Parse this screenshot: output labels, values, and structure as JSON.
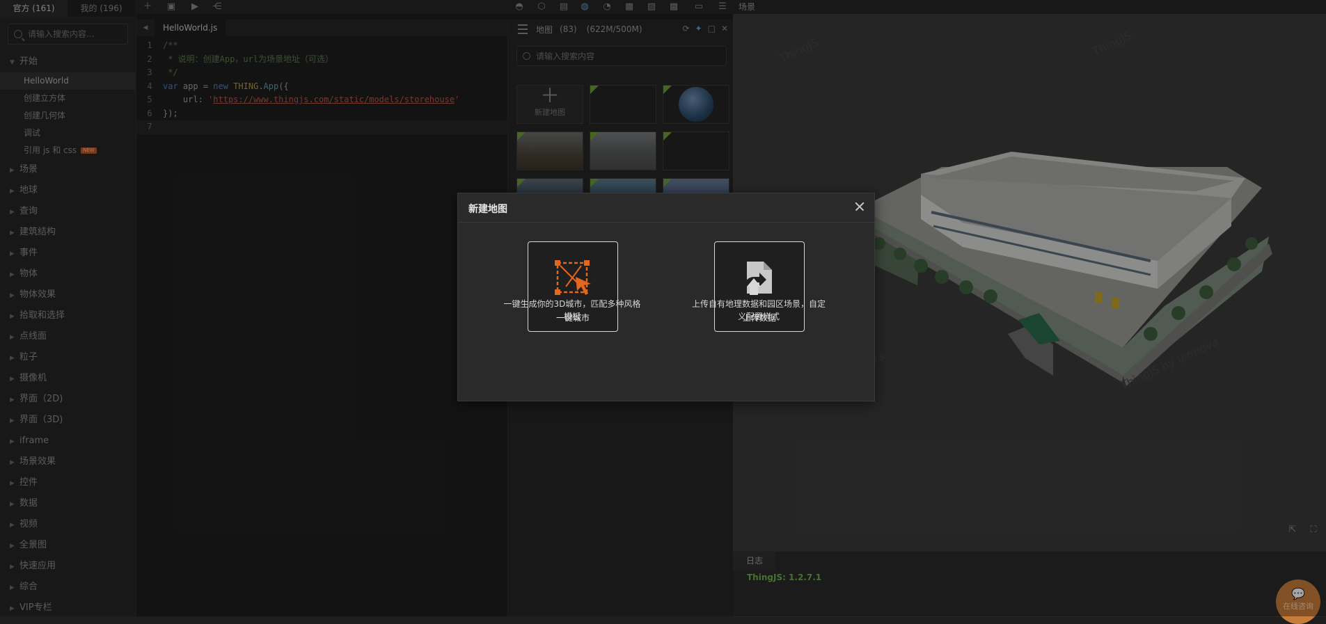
{
  "sidebar": {
    "tabs": [
      {
        "label": "官方 (161)"
      },
      {
        "label": "我的 (196)"
      }
    ],
    "search_placeholder": "请输入搜索内容...",
    "start_section": "开始",
    "start_items": [
      {
        "label": "HelloWorld",
        "active": true
      },
      {
        "label": "创建立方体"
      },
      {
        "label": "创建几何体"
      },
      {
        "label": "调试"
      },
      {
        "label": "引用 js 和 css",
        "badge": "NEW"
      }
    ],
    "sections": [
      "场景",
      "地球",
      "查询",
      "建筑结构",
      "事件",
      "物体",
      "物体效果",
      "拾取和选择",
      "点线面",
      "粒子",
      "摄像机",
      "界面（2D)",
      "界面（3D)",
      "iframe",
      "场景效果",
      "控件",
      "数据",
      "视频",
      "全景图",
      "快速应用",
      "综合",
      "VIP专栏"
    ]
  },
  "toolbar": {
    "icons": [
      "add-icon",
      "save-icon",
      "run-icon",
      "share-icon",
      "sphere-icon",
      "cube-icon",
      "folder-icon",
      "globe-icon",
      "chart-icon",
      "layout-icon",
      "image-icon",
      "picture-icon",
      "document-icon",
      "list-icon"
    ],
    "scene_label": "场景"
  },
  "editor": {
    "file_tab": "HelloWorld.js",
    "lines": [
      "1",
      "2",
      "3",
      "4",
      "5",
      "6",
      "7"
    ],
    "code": {
      "l1": "/**",
      "l2": " * 说明：创建App，url为场景地址（可选）",
      "l3": " */",
      "l4_kw1": "var",
      "l4_mid": " app = ",
      "l4_kw2": "new",
      "l4_cls": "THING",
      "l4_dot": ".",
      "l4_app": "App",
      "l4_end": "({",
      "l5_key": "    url: ",
      "l5_quote_open": "'",
      "l5_url": "https://www.thingjs.com/static/models/storehouse",
      "l5_quote_close": "'",
      "l6": "});",
      "l7": ""
    }
  },
  "map_panel": {
    "title": "地图",
    "count": "(83)",
    "size": "(622M/500M)",
    "search_placeholder": "请输入搜索内容",
    "new_map_label": "新建地图"
  },
  "log": {
    "tab": "日志",
    "line": "ThingJS: 1.2.7.1",
    "consult_label": "在线咨询"
  },
  "modal": {
    "title": "新建地图",
    "options": [
      {
        "label": "一键城市",
        "desc_line1": "一键生成你的3D城市，匹配多种风格",
        "desc_line2": "模板"
      },
      {
        "label": "上传数据",
        "desc_line1": "上传自有地理数据和园区场景，自定",
        "desc_line2": "义配置样式"
      }
    ]
  },
  "colors": {
    "accent_orange": "#e2671f",
    "log_green": "#6fae4a",
    "consult_bg": "#c67c3a"
  }
}
